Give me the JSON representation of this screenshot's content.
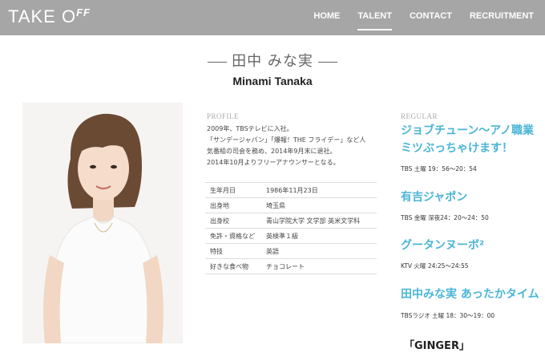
{
  "header": {
    "logo": {
      "text": "TAKE O",
      "suffix": "FF"
    },
    "nav": [
      {
        "label": "HOME"
      },
      {
        "label": "TALENT",
        "active": true
      },
      {
        "label": "CONTACT"
      },
      {
        "label": "RECRUITMENT"
      }
    ]
  },
  "talent": {
    "name_jp": "田中 みな実",
    "name_en": "Minami Tanaka"
  },
  "profile": {
    "label": "PROFILE",
    "bio_lines": [
      "2009年、TBSテレビに入社。",
      "「サンデージャパン」「爆報！THE フライデー」など人",
      "気番組の司会を務め、2014年9月末に退社。",
      "2014年10月よりフリーアナウンサーとなる。"
    ],
    "facts": [
      {
        "key": "生年月日",
        "value": "1986年11月23日"
      },
      {
        "key": "出身地",
        "value": "埼玉県"
      },
      {
        "key": "出身校",
        "value": "青山学院大学 文学部 英米文学科"
      },
      {
        "key": "免許・資格など",
        "value": "英検準１級"
      },
      {
        "key": "特技",
        "value": "英語"
      },
      {
        "key": "好きな食べ物",
        "value": "チョコレート"
      }
    ]
  },
  "regular": {
    "label": "REGULAR",
    "shows": [
      {
        "title_lines": [
          "ジョブチューン～アノ職業",
          "ミツぶっちゃけます！"
        ],
        "time": "TBS 土曜 19：56～20：54"
      },
      {
        "title_lines": [
          "有吉ジャポン"
        ],
        "time": "TBS 金曜 深夜24：20～24：50"
      },
      {
        "title_lines": [
          "グータンヌーボ²"
        ],
        "time": "KTV 火曜 24:25～24:55"
      },
      {
        "title_lines": [
          "田中みな実 あったかタイム"
        ],
        "time": "TBSラジオ 土曜 18：30～19：00"
      }
    ],
    "magazine": "「GINGER」"
  },
  "colors": {
    "header_bg": "#a6a6a6",
    "accent": "#4bb5d6"
  }
}
